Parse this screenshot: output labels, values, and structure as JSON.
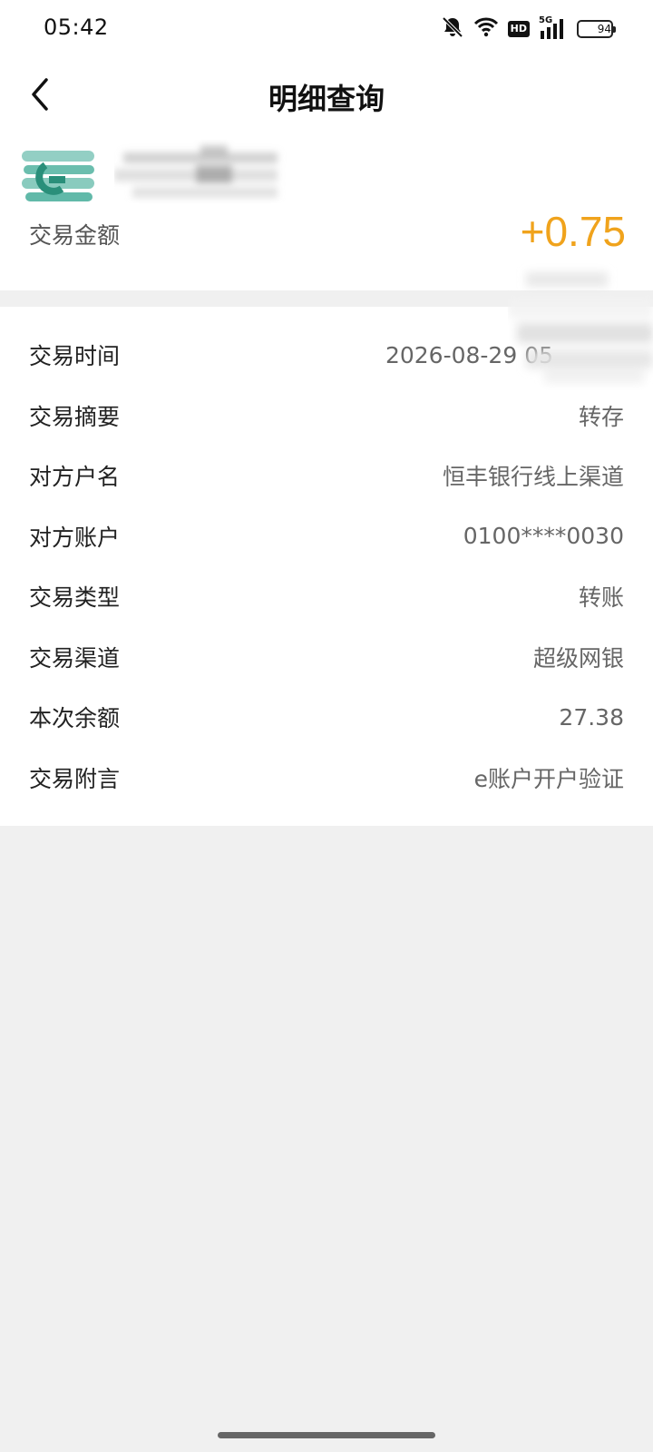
{
  "status_bar": {
    "time": "05:42",
    "network": "5G",
    "hd_label": "HD",
    "battery": "94",
    "icons": [
      "mute-bell-icon",
      "wifi-icon",
      "hd-icon",
      "signal-5g-icon",
      "battery-icon"
    ]
  },
  "header": {
    "title": "明细查询",
    "back_icon": "chevron-left-icon"
  },
  "summary": {
    "amount_label": "交易金额",
    "amount_value": "+0.75",
    "amount_color": "#f0a31c"
  },
  "details": [
    {
      "label": "交易时间",
      "value": "2026-08-29 05"
    },
    {
      "label": "交易摘要",
      "value": "转存"
    },
    {
      "label": "对方户名",
      "value": "恒丰银行线上渠道"
    },
    {
      "label": "对方账户",
      "value": "0100****0030"
    },
    {
      "label": "交易类型",
      "value": "转账"
    },
    {
      "label": "交易渠道",
      "value": "超级网银"
    },
    {
      "label": "本次余额",
      "value": "27.38"
    },
    {
      "label": "交易附言",
      "value": "e账户开户验证"
    }
  ],
  "colors": {
    "accent": "#f0a31c",
    "logo": "#3aa893",
    "background": "#f0f0f0"
  }
}
